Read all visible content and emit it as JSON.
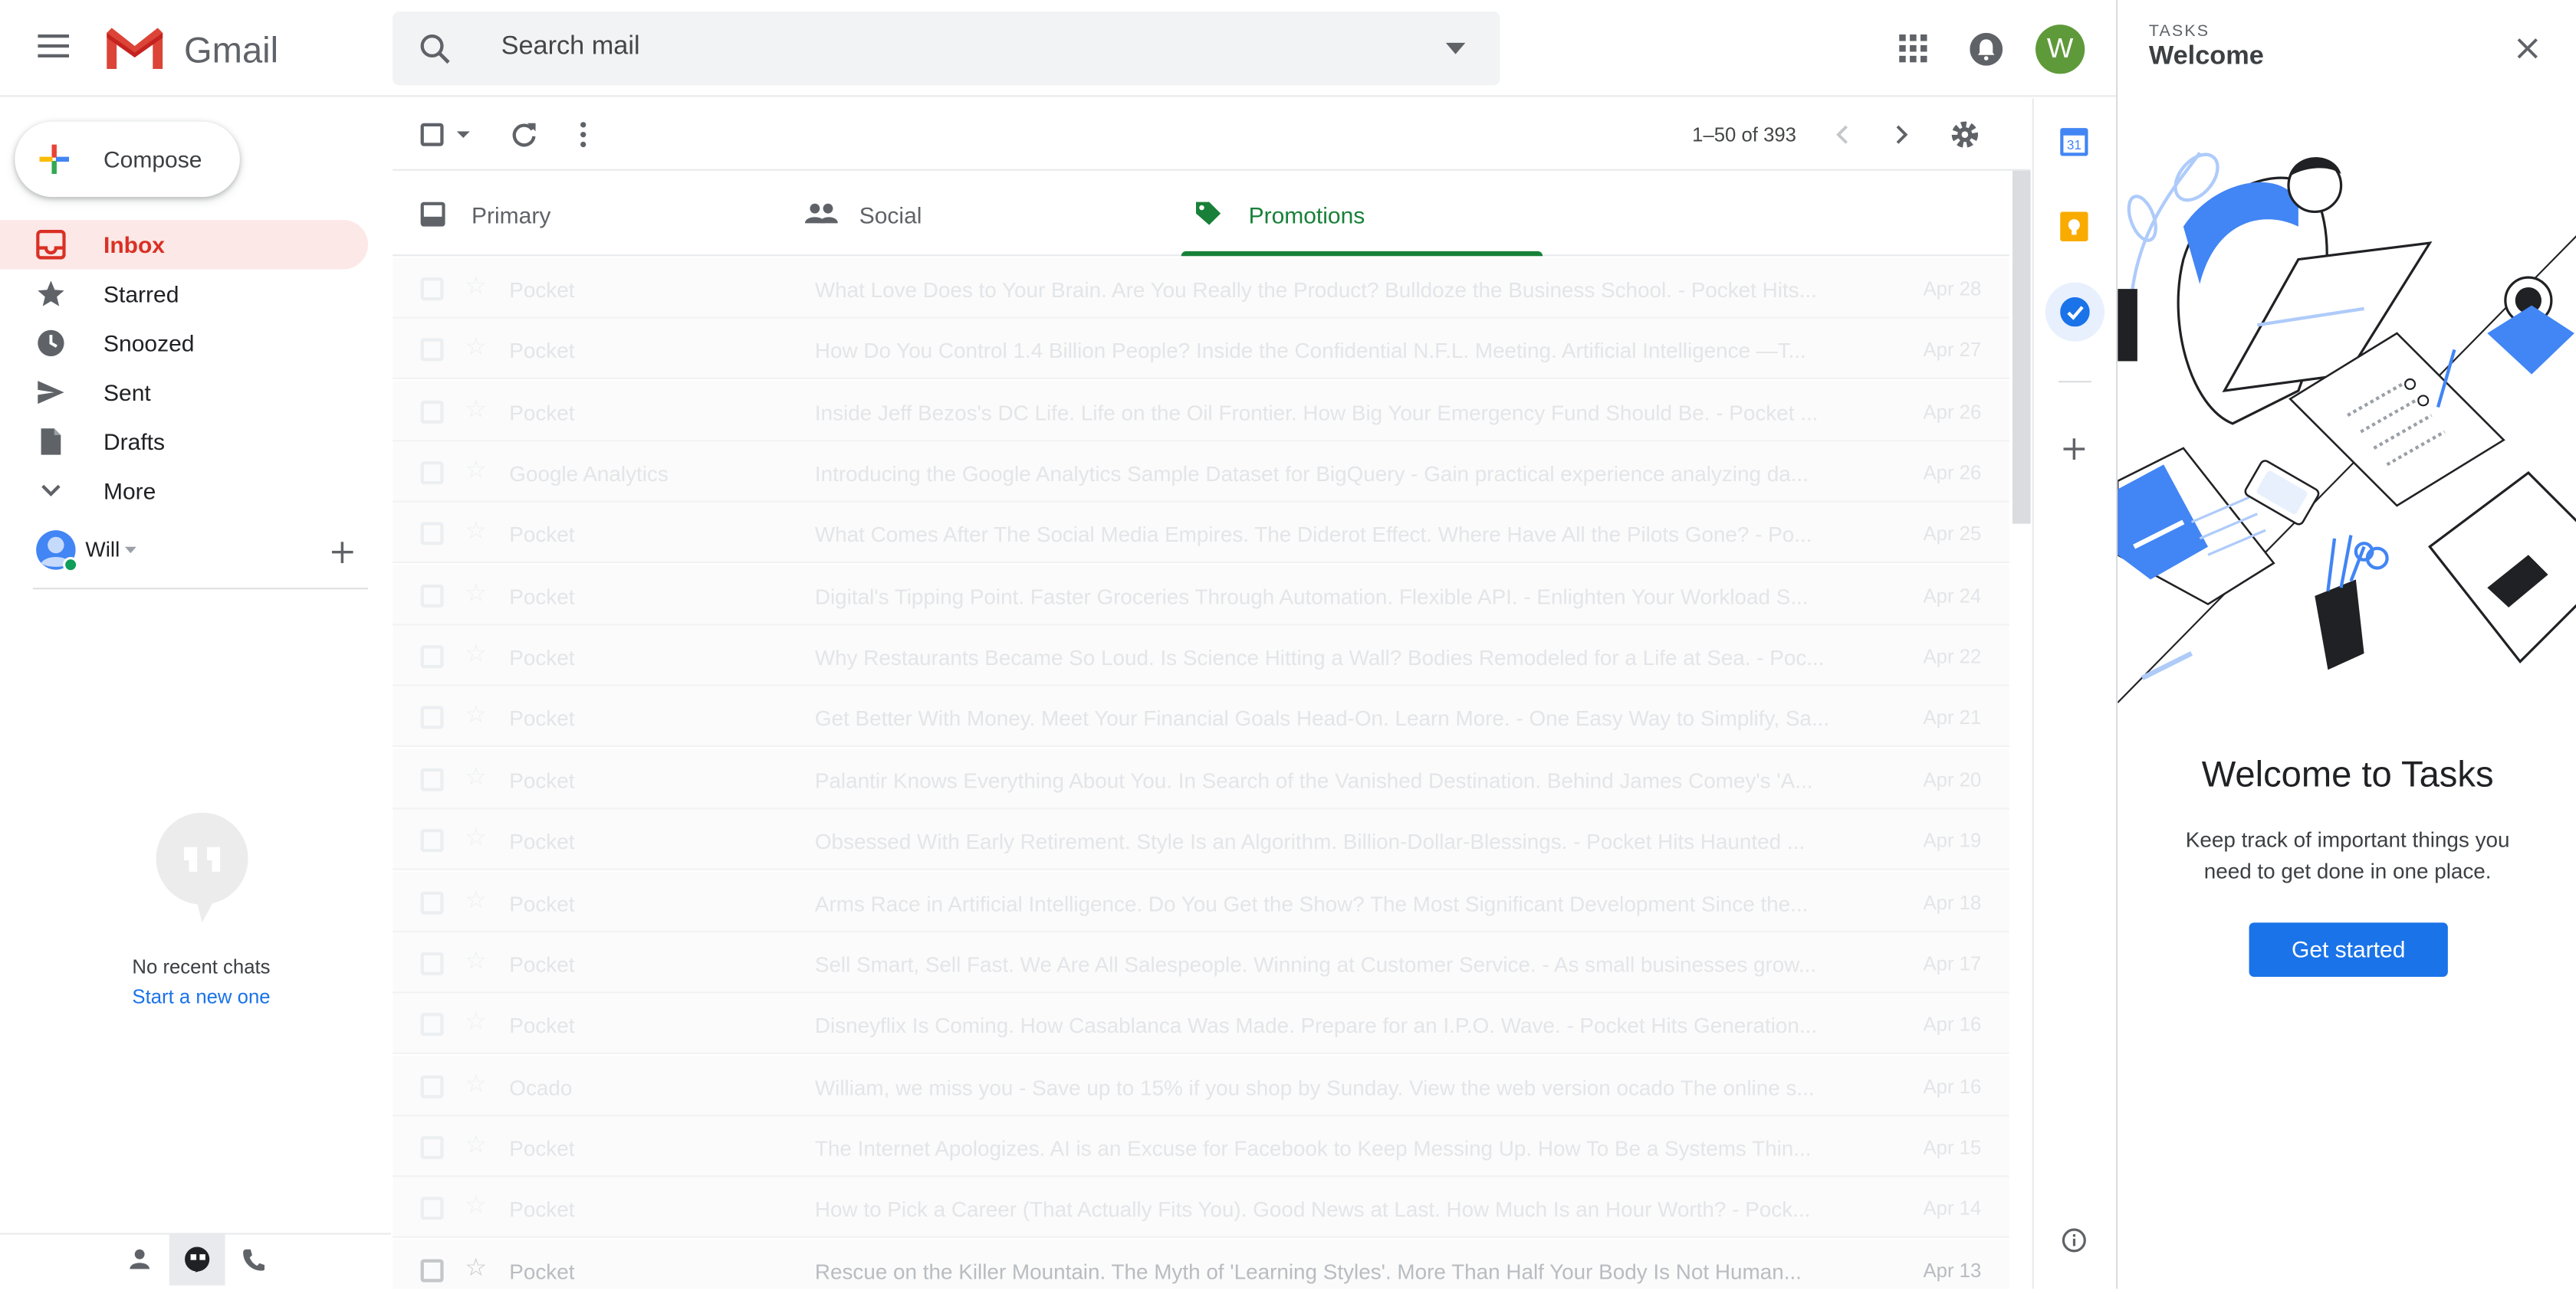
{
  "app": {
    "name": "Gmail"
  },
  "search": {
    "placeholder": "Search mail"
  },
  "account": {
    "initial": "W",
    "chat_user": "Will"
  },
  "compose": {
    "label": "Compose"
  },
  "nav": [
    {
      "label": "Inbox",
      "icon": "inbox-icon",
      "active": true
    },
    {
      "label": "Starred",
      "icon": "star-icon"
    },
    {
      "label": "Snoozed",
      "icon": "clock-icon"
    },
    {
      "label": "Sent",
      "icon": "send-icon"
    },
    {
      "label": "Drafts",
      "icon": "draft-icon"
    },
    {
      "label": "More",
      "icon": "chevron-down-icon"
    }
  ],
  "chat": {
    "empty": "No recent chats",
    "start": "Start a new one"
  },
  "pager": {
    "range": "1–50 of 393"
  },
  "tabs": [
    {
      "label": "Primary",
      "icon": "inbox-tab-icon"
    },
    {
      "label": "Social",
      "icon": "people-icon"
    },
    {
      "label": "Promotions",
      "icon": "tag-icon",
      "active": true
    }
  ],
  "emails": [
    {
      "sender": "Pocket",
      "subject": "What Love Does to Your Brain. Are You Really the Product? Bulldoze the Business School.",
      "snippet": " - Pocket Hits...",
      "date": "Apr 28"
    },
    {
      "sender": "Pocket",
      "subject": "How Do You Control 1.4 Billion People? Inside the Confidential N.F.L. Meeting. Artificial Intelligence —T...",
      "snippet": "",
      "date": "Apr 27"
    },
    {
      "sender": "Pocket",
      "subject": "Inside Jeff Bezos's DC Life. Life on the Oil Frontier. How Big Your Emergency Fund Should Be.",
      "snippet": " - Pocket ...",
      "date": "Apr 26"
    },
    {
      "sender": "Google Analytics",
      "subject": "Introducing the Google Analytics Sample Dataset for BigQuery",
      "snippet": " - Gain practical experience analyzing da...",
      "date": "Apr 26"
    },
    {
      "sender": "Pocket",
      "subject": "What Comes After The Social Media Empires. The Diderot Effect. Where Have All the Pilots Gone?",
      "snippet": " - Po...",
      "date": "Apr 25"
    },
    {
      "sender": "Pocket",
      "subject": "Digital's Tipping Point. Faster Groceries Through Automation. Flexible API.",
      "snippet": " - Enlighten Your Workload S...",
      "date": "Apr 24"
    },
    {
      "sender": "Pocket",
      "subject": "Why Restaurants Became So Loud. Is Science Hitting a Wall? Bodies Remodeled for a Life at Sea.",
      "snippet": " - Poc...",
      "date": "Apr 22"
    },
    {
      "sender": "Pocket",
      "subject": "Get Better With Money. Meet Your Financial Goals Head-On. Learn More.",
      "snippet": " - One Easy Way to Simplify, Sa...",
      "date": "Apr 21"
    },
    {
      "sender": "Pocket",
      "subject": "Palantir Knows Everything About You. In Search of the Vanished Destination. Behind James Comey's 'A...",
      "snippet": "",
      "date": "Apr 20"
    },
    {
      "sender": "Pocket",
      "subject": "Obsessed With Early Retirement. Style Is an Algorithm. Billion-Dollar-Blessings.",
      "snippet": " - Pocket Hits Haunted ...",
      "date": "Apr 19"
    },
    {
      "sender": "Pocket",
      "subject": "Arms Race in Artificial Intelligence. Do You Get the Show? The Most Significant Development Since the...",
      "snippet": "",
      "date": "Apr 18"
    },
    {
      "sender": "Pocket",
      "subject": "Sell Smart, Sell Fast. We Are All Salespeople. Winning at Customer Service.",
      "snippet": " - As small businesses grow...",
      "date": "Apr 17"
    },
    {
      "sender": "Pocket",
      "subject": "Disneyflix Is Coming. How Casablanca Was Made. Prepare for an I.P.O. Wave.",
      "snippet": " - Pocket Hits Generation...",
      "date": "Apr 16"
    },
    {
      "sender": "Ocado",
      "subject": "William, we miss you",
      "snippet": " - Save up to 15% if you shop by Sunday. View the web version ocado The online s...",
      "date": "Apr 16"
    },
    {
      "sender": "Pocket",
      "subject": "The Internet Apologizes. AI is an Excuse for Facebook to Keep Messing Up. How To Be a Systems Thin...",
      "snippet": "",
      "date": "Apr 15"
    },
    {
      "sender": "Pocket",
      "subject": "How to Pick a Career (That Actually Fits You). Good News at Last. How Much Is an Hour Worth?",
      "snippet": " - Pock...",
      "date": "Apr 14"
    },
    {
      "sender": "Pocket",
      "subject": "Rescue on the Killer Mountain. The Myth of 'Learning Styles'. More Than Half Your Body Is Not Human...",
      "snippet": "",
      "date": "Apr 13"
    }
  ],
  "tasks": {
    "kicker": "TASKS",
    "title": "Welcome",
    "heading": "Welcome to Tasks",
    "body": "Keep track of important things you need to get done in one place.",
    "cta": "Get started"
  },
  "rail": {
    "calendar_day": "31"
  },
  "colors": {
    "accent": "#1a73e8",
    "inbox_red": "#d93025",
    "promotions_green": "#188038"
  }
}
